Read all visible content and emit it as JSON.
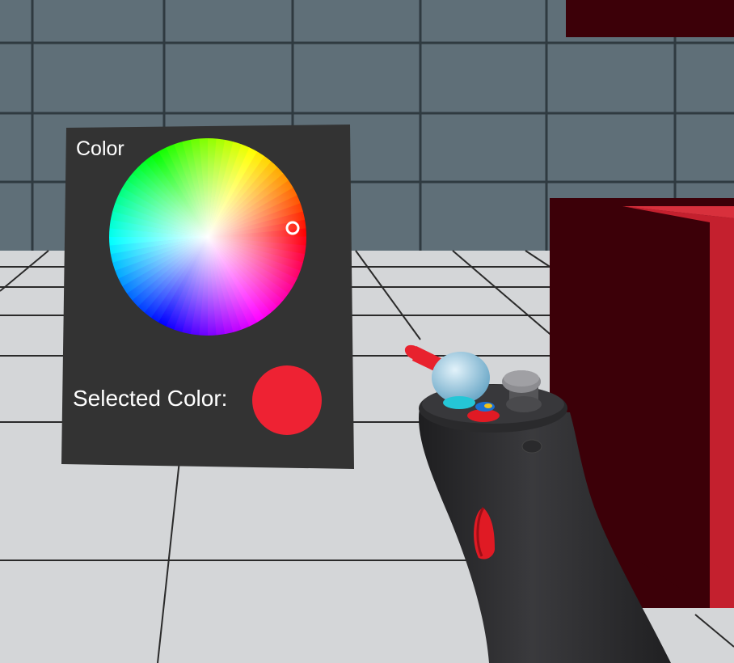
{
  "color_picker": {
    "title": "Color",
    "selected_label": "Selected Color:",
    "selected_color": "#ee2233",
    "selection_hue_degrees": 5,
    "selection_saturation": 0.82
  },
  "scene": {
    "wall_color": "#5f6f78",
    "floor_color": "#d4d6d8",
    "box_color": "#c4202e",
    "box_shadow_color": "#3c0008"
  },
  "controller": {
    "body_color": "#2e2e30",
    "pointer_color": "#e8222e",
    "sphere_color": "#a8d4ea",
    "button_cyan": "#25c6d6",
    "button_red": "#e01a24"
  }
}
